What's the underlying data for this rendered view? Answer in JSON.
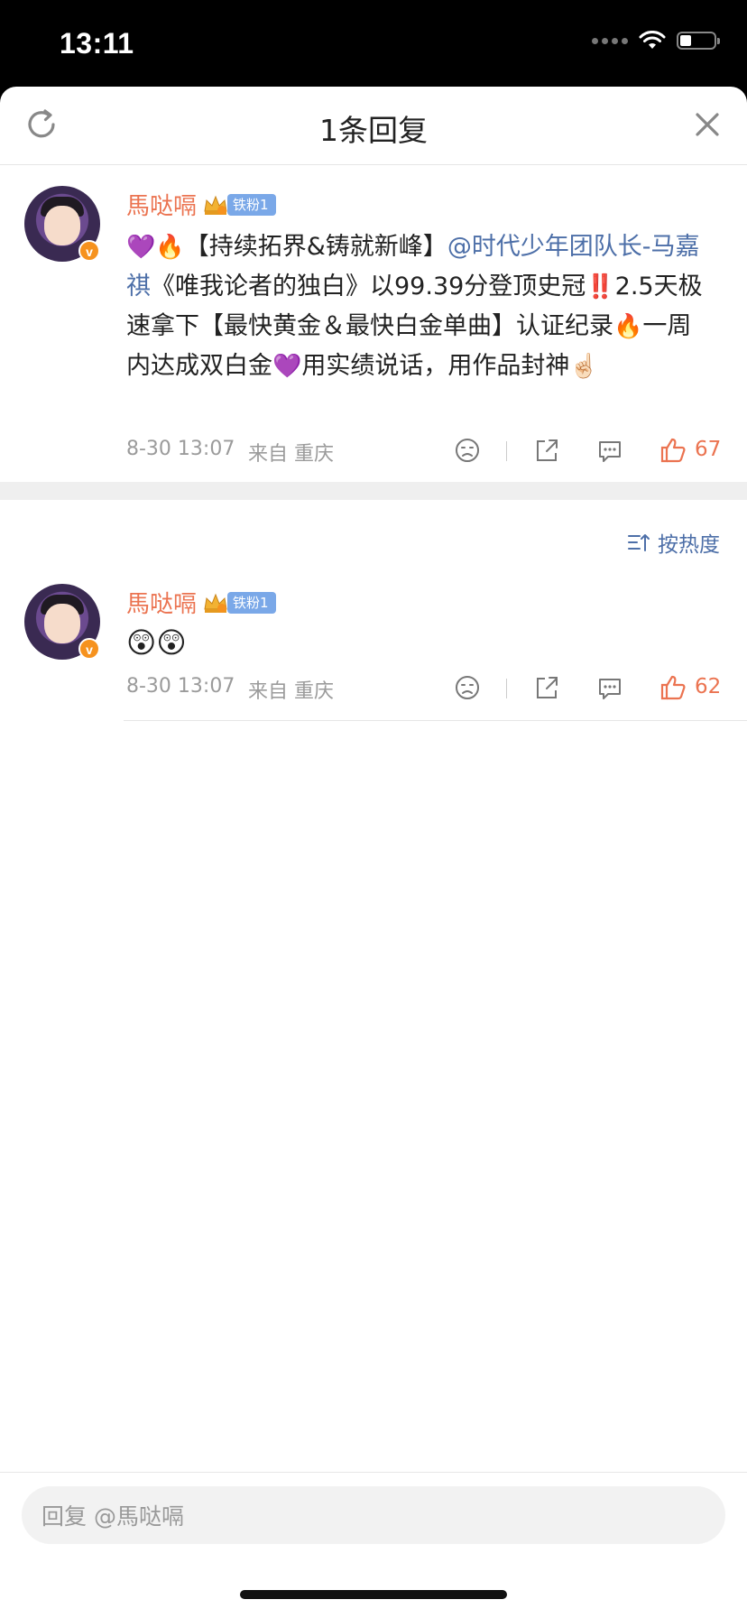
{
  "status_bar": {
    "time": "13:11"
  },
  "header": {
    "title": "1条回复",
    "refresh_icon": "refresh-icon",
    "close_icon": "close-icon"
  },
  "main_comment": {
    "username": "馬哒嗝",
    "fan_badge": "铁粉1",
    "content_segments": {
      "e1": "💜",
      "e2": "🔥",
      "t1": "【持续拓界&铸就新峰】",
      "mention": "@时代少年团队长-马嘉祺",
      "t2": "《唯我论者的独白》以99.39分登顶史冠",
      "e3": "‼️",
      "t3": "2.5天极速拿下【最快黄金＆最快白金单曲】认证纪录",
      "e4": "🔥",
      "t4": "一周内达成双白金",
      "e5": "💜",
      "t5": "用实绩说话，用作品封神",
      "e6": "☝🏻"
    },
    "time": "8-30 13:07",
    "source": "来自 重庆",
    "likes": "67"
  },
  "sort": {
    "label": "按热度"
  },
  "reply": {
    "username": "馬哒嗝",
    "fan_badge": "铁粉1",
    "content": "😲😲",
    "time": "8-30 13:07",
    "source": "来自 重庆",
    "likes": "62"
  },
  "bottom_bar": {
    "reply_placeholder": "回复 @馬哒嗝"
  },
  "colors": {
    "accent": "#eb7350",
    "link": "#4d6fa8",
    "badge": "#7aa8e8",
    "verified": "#f6921e"
  }
}
